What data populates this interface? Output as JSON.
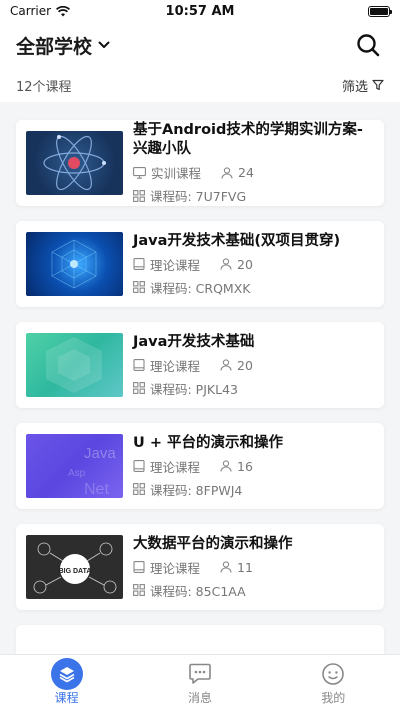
{
  "status": {
    "carrier": "Carrier",
    "time": "10:57 AM"
  },
  "header": {
    "school": "全部学校"
  },
  "subbar": {
    "count": "12个课程",
    "filter": "筛选"
  },
  "courses": [
    {
      "title": "基于Android技术的学期实训方案-兴趣小队",
      "type": "实训课程",
      "type_icon": "monitor-icon",
      "members": "24",
      "code": "课程码: 7U7FVG"
    },
    {
      "title": "Java开发技术基础(双项目贯穿)",
      "type": "理论课程",
      "type_icon": "book-icon",
      "members": "20",
      "code": "课程码: CRQMXK"
    },
    {
      "title": "Java开发技术基础",
      "type": "理论课程",
      "type_icon": "book-icon",
      "members": "20",
      "code": "课程码: PJKL43"
    },
    {
      "title": "U + 平台的演示和操作",
      "type": "理论课程",
      "type_icon": "book-icon",
      "members": "16",
      "code": "课程码: 8FPWJ4"
    },
    {
      "title": "大数据平台的演示和操作",
      "type": "理论课程",
      "type_icon": "book-icon",
      "members": "11",
      "code": "课程码: 85C1AA"
    }
  ],
  "thumb_text": {
    "t4": [
      "Java",
      "Asp",
      "Net"
    ],
    "t5": "BIG DATA"
  },
  "tabs": [
    {
      "label": "课程",
      "active": true
    },
    {
      "label": "消息",
      "active": false
    },
    {
      "label": "我的",
      "active": false
    }
  ],
  "colors": {
    "accent": "#3b74e8"
  }
}
